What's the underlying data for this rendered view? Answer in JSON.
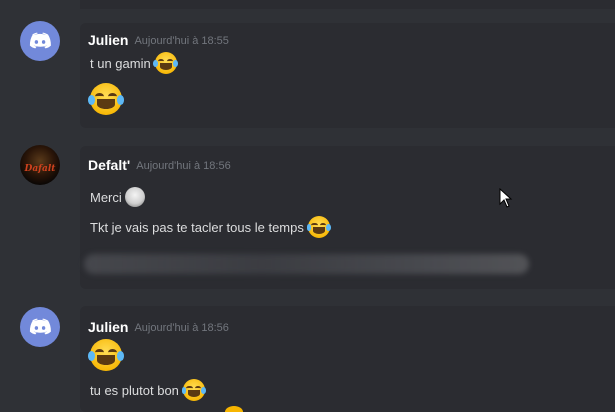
{
  "messages": [
    {
      "author": "Julien",
      "timestamp": "Aujourd'hui à 18:55",
      "avatar": "discord-logo-icon",
      "lines": [
        "t un gamin",
        ""
      ]
    },
    {
      "author": "Defalt'",
      "timestamp": "Aujourd'hui à 18:56",
      "avatar": "user-avatar",
      "lines": [
        "Merci",
        "Tkt je vais pas te tacler tous le temps"
      ],
      "blurred_line": true
    },
    {
      "author": "Julien",
      "timestamp": "Aujourd'hui à 18:56",
      "avatar": "discord-logo-icon",
      "lines": [
        "",
        "tu es plutot bon"
      ]
    }
  ],
  "colors": {
    "background": "#2f3136",
    "card": "#2b2c31",
    "discord_blurple": "#7289da",
    "author": "#ffffff",
    "text": "#dcddde",
    "timestamp": "#72767d"
  }
}
